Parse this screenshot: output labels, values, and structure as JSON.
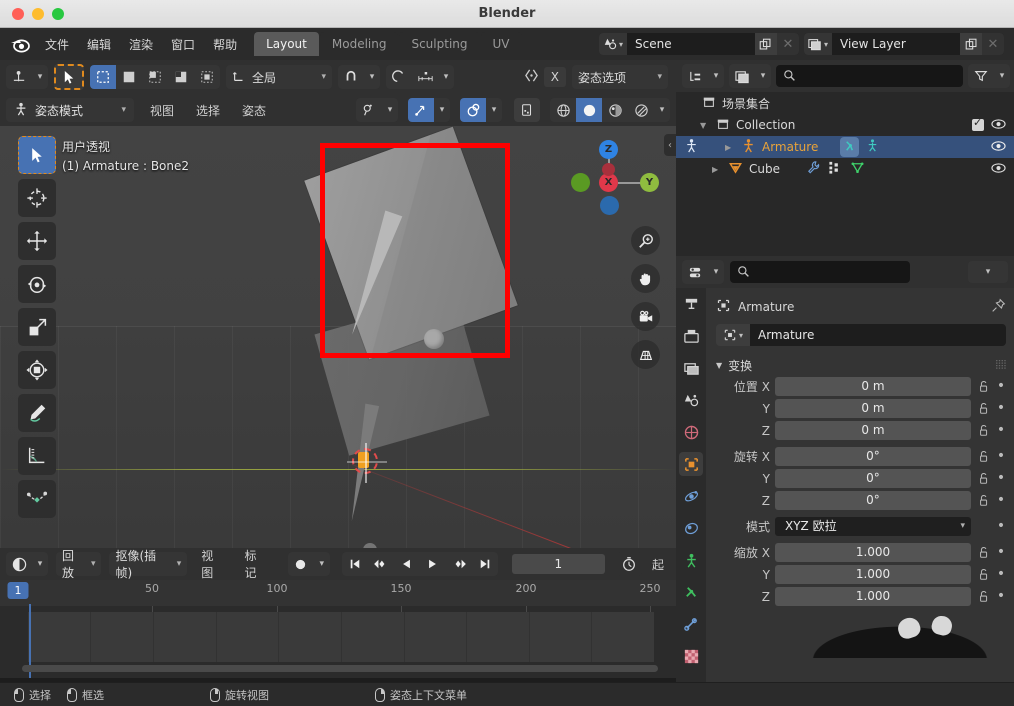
{
  "window": {
    "title": "Blender"
  },
  "menubar": {
    "logo_icon": "blender-logo-icon",
    "items": [
      "文件",
      "编辑",
      "渲染",
      "窗口",
      "帮助"
    ],
    "workspace_tabs": [
      {
        "label": "Layout",
        "active": true
      },
      {
        "label": "Modeling",
        "active": false
      },
      {
        "label": "Sculpting",
        "active": false
      },
      {
        "label": "UV",
        "active": false
      }
    ],
    "scene": {
      "icon": "scene-icon",
      "name": "Scene",
      "copy_icon": "duplicate-icon",
      "close_icon": "close-icon"
    },
    "view_layer": {
      "icon": "view-layer-icon",
      "name": "View Layer",
      "copy_icon": "duplicate-icon",
      "close_icon": "close-icon"
    }
  },
  "tool_header": {
    "editor_type_icon": "editor-type-icon",
    "cursor_tool_icon": "tweak-cursor-icon",
    "select_modes": [
      "select-new-icon",
      "select-extend-icon",
      "select-subtract-icon",
      "select-invert-icon",
      "select-intersect-icon"
    ],
    "transform_orientation": {
      "icon": "orientation-icon",
      "label": "全局"
    },
    "snap_icon": "snap-magnet-icon",
    "proportional_icon": "proportional-edit-icon",
    "proportional_falloff_icon": "falloff-icon",
    "mirror_icon": "x-mirror-icon",
    "mirror_axis": "X",
    "options_label": "姿态选项"
  },
  "viewport_header": {
    "mode": {
      "icon": "pose-mode-icon",
      "label": "姿态模式"
    },
    "menus": [
      "视图",
      "选择",
      "姿态"
    ],
    "visibility_icon": "visibility-icon",
    "gizmo_icon": "gizmo-icon",
    "overlays_icon": "overlays-icon",
    "xray_icon": "xray-icon",
    "shading_modes": [
      "wireframe-icon",
      "solid-icon",
      "material-preview-icon",
      "rendered-icon"
    ],
    "active_shading": "solid-icon"
  },
  "viewport": {
    "overlay_line1": "用户透视",
    "overlay_line2": "(1) Armature : Bone2",
    "annotation_color": "#ff0000",
    "gizmo": {
      "axes": [
        {
          "label": "Z",
          "color": "#2f83e3"
        },
        {
          "label": "Y",
          "color": "#8fbc3f"
        },
        {
          "label": "X",
          "color": "#e0384a"
        }
      ]
    },
    "nav_buttons": [
      "zoom-icon",
      "pan-hand-icon",
      "camera-view-icon",
      "toggle-ortho-grid-icon"
    ],
    "tools": [
      {
        "name": "tweak-select-tool",
        "icon": "cursor-arrow-icon",
        "active": true
      },
      {
        "name": "cursor-tool",
        "icon": "3d-cursor-icon",
        "active": false
      },
      {
        "name": "move-tool",
        "icon": "move-arrows-icon",
        "active": false
      },
      {
        "name": "rotate-tool",
        "icon": "rotate-icon",
        "active": false
      },
      {
        "name": "scale-tool",
        "icon": "scale-icon",
        "active": false
      },
      {
        "name": "transform-tool",
        "icon": "transform-icon",
        "active": false
      },
      {
        "name": "annotate-tool",
        "icon": "pencil-icon",
        "active": false
      },
      {
        "name": "measure-tool",
        "icon": "ruler-icon",
        "active": false
      },
      {
        "name": "bendy-bone-tool",
        "icon": "curve-handle-icon",
        "active": false
      }
    ]
  },
  "timeline": {
    "editor_icon": "timeline-editor-icon",
    "menus": [
      "回放",
      "抠像(插帧)",
      "视图",
      "标记"
    ],
    "record_icon": "record-keying-icon",
    "transport": [
      "jump-start-icon",
      "prev-keyframe-icon",
      "play-reverse-icon",
      "play-icon",
      "next-keyframe-icon",
      "jump-end-icon"
    ],
    "current_frame": "1",
    "auto_key_icon": "stopwatch-icon",
    "start_label": "起",
    "ruler_ticks": [
      "50",
      "100",
      "150",
      "200",
      "250"
    ],
    "playhead_frame": "1"
  },
  "outliner": {
    "display_mode_icon": "outliner-display-icon",
    "filter_id_icon": "filter-id-icon",
    "search_placeholder": "",
    "search_icon": "search-icon",
    "filter_icon": "funnel-icon",
    "new_collection_icon": "new-collection-icon",
    "rows": [
      {
        "name": "场景集合",
        "icon": "scene-collection-icon",
        "indent": 0,
        "selected": false,
        "expandable": false
      },
      {
        "name": "Collection",
        "icon": "collection-icon",
        "indent": 1,
        "selected": false,
        "expandable": true,
        "checkbox": true,
        "eye": true
      },
      {
        "name": "Armature",
        "icon": "armature-icon",
        "indent": 2,
        "selected": true,
        "expandable": true,
        "eye": true,
        "extra_icons": [
          "pose-icon",
          "armature-data-icon"
        ]
      },
      {
        "name": "Cube",
        "icon": "mesh-icon",
        "indent": 2,
        "selected": false,
        "expandable": true,
        "eye": true,
        "extra_icons": [
          "modifier-wrench-icon",
          "vertex-group-icon",
          "mesh-data-icon"
        ]
      }
    ]
  },
  "properties": {
    "editor_icon": "properties-editor-icon",
    "search_placeholder": "",
    "search_icon": "search-icon",
    "options_chevron_icon": "chevron-down-icon",
    "tabs": [
      {
        "name": "tool-tab",
        "icon": "tool-icon",
        "active": false
      },
      {
        "name": "render-tab",
        "icon": "camera-back-icon",
        "active": false
      },
      {
        "name": "output-tab",
        "icon": "printer-icon",
        "active": false
      },
      {
        "name": "view-layer-tab",
        "icon": "images-icon",
        "active": false
      },
      {
        "name": "scene-tab",
        "icon": "scene-cone-icon",
        "active": false
      },
      {
        "name": "world-tab",
        "icon": "world-globe-icon",
        "active": false
      },
      {
        "name": "object-tab",
        "icon": "object-square-icon",
        "active": true
      },
      {
        "name": "modifiers-tab",
        "icon": "physics-orbit-icon",
        "active": false
      },
      {
        "name": "particles-tab",
        "icon": "particles-icon",
        "active": false
      },
      {
        "name": "physics-tab",
        "icon": "physics-bounce-icon",
        "active": false
      },
      {
        "name": "object-constraints-tab",
        "icon": "bone-constraint-icon",
        "active": false
      },
      {
        "name": "object-data-tab",
        "icon": "armature-data-icon",
        "active": false
      },
      {
        "name": "texture-tab",
        "icon": "checker-texture-icon",
        "active": false
      }
    ],
    "breadcrumb": {
      "icon": "object-square-icon",
      "label": "Armature",
      "pin_icon": "pin-icon"
    },
    "id_field": {
      "icon": "object-square-icon",
      "value": "Armature"
    },
    "transform_section": {
      "title": "变换",
      "collapse_icon": "triangle-down-icon",
      "grip_icon": "grip-icon",
      "location": {
        "label": "位置",
        "axes": [
          "X",
          "Y",
          "Z"
        ],
        "values": [
          "0 m",
          "0 m",
          "0 m"
        ]
      },
      "rotation": {
        "label": "旋转",
        "axes": [
          "X",
          "Y",
          "Z"
        ],
        "values": [
          "0°",
          "0°",
          "0°"
        ]
      },
      "rotation_mode": {
        "label": "模式",
        "value": "XYZ 欧拉"
      },
      "scale": {
        "label": "缩放",
        "axes": [
          "X",
          "Y",
          "Z"
        ],
        "values": [
          "1.000",
          "1.000",
          "1.000"
        ]
      },
      "lock_icon": "unlock-icon",
      "animate_icon": "animate-dot-icon"
    }
  },
  "status_bar": {
    "items": [
      {
        "mouse": "left",
        "label": "选择"
      },
      {
        "mouse": "left-drag",
        "label": "框选"
      },
      {
        "mouse": "middle",
        "label": "旋转视图"
      },
      {
        "mouse": "right",
        "label": "姿态上下文菜单"
      }
    ]
  }
}
